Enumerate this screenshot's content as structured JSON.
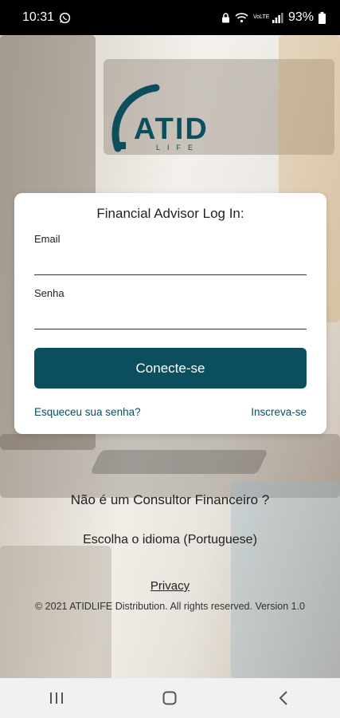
{
  "status_bar": {
    "time": "10:31",
    "battery": "93%",
    "volte_label": "VoLTE"
  },
  "logo": {
    "text": "ATID",
    "subtext": "LIFE",
    "color": "#0b4f5e"
  },
  "login_card": {
    "title": "Financial Advisor Log In:",
    "email_label": "Email",
    "email_value": "",
    "password_label": "Senha",
    "password_value": "",
    "submit_label": "Conecte-se",
    "forgot_label": "Esqueceu sua senha?",
    "signup_label": "Inscreva-se"
  },
  "footer": {
    "not_advisor": "Não é um Consultor Financeiro ?",
    "language": "Escolha o idioma (Portuguese)",
    "privacy": "Privacy",
    "copyright": "© 2021 ATIDLIFE Distribution. All rights reserved. Version 1.0"
  },
  "nav_bar": {
    "recents_icon": "recents-icon",
    "home_icon": "home-icon",
    "back_icon": "back-icon"
  },
  "colors": {
    "primary": "#0b4f5e",
    "status_bar": "#000000",
    "card": "#ffffff"
  }
}
